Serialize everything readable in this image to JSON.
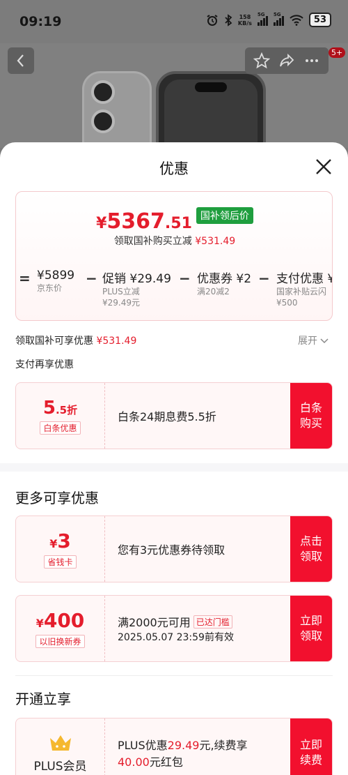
{
  "status_bar": {
    "time": "09:19",
    "speed_value": "158",
    "speed_unit": "KB/s",
    "sig1": "5G",
    "sig2": "5G",
    "battery": "53"
  },
  "header": {
    "cart_badge": "5+"
  },
  "sheet": {
    "title": "优惠",
    "price": {
      "yen": "¥",
      "integer": "5367",
      "decimal": ".51",
      "tag": "国补领后价",
      "sub_text": "领取国补购买立减",
      "sub_amount": "¥531.49"
    },
    "breakdown": [
      {
        "op": "=",
        "main": "¥5899",
        "sub1": "京东价",
        "sub2": ""
      },
      {
        "op": "−",
        "main": "促销 ¥29.49",
        "sub1": "PLUS立减",
        "sub2": "¥29.49元"
      },
      {
        "op": "−",
        "main": "优惠券 ¥2",
        "sub1": "满20减2",
        "sub2": ""
      },
      {
        "op": "−",
        "main": "支付优惠 ¥",
        "sub1": "国家补贴云闪",
        "sub2": "¥500"
      }
    ],
    "subsidy_label": "领取国补可享优惠",
    "subsidy_amount": "¥531.49",
    "expand_label": "展开",
    "pay_again_label": "支付再享优惠",
    "baitiao": {
      "big_num": "5",
      "big_suffix": ".5折",
      "chip": "白条优惠",
      "text": "白条24期息费5.5折",
      "action": "白条购买"
    },
    "more_title": "更多可享优惠",
    "coupon1": {
      "yen": "¥",
      "num": "3",
      "chip": "省钱卡",
      "text": "您有3元优惠券待领取",
      "action": "点击领取"
    },
    "coupon2": {
      "yen": "¥",
      "num": "400",
      "chip": "以旧换新券",
      "line1": "满2000元可用",
      "reached": "已达门槛",
      "line2": "2025.05.07 23:59前有效",
      "action": "立即领取"
    },
    "open_title": "开通立享",
    "plus": {
      "name": "PLUS会员",
      "t1": "PLUS优惠",
      "t2": "29.49",
      "t3": "元,续费享",
      "t4": "40.00",
      "t5": "元红包",
      "action": "立即续费"
    }
  },
  "colors": {
    "accent_red": "#e41d2c",
    "action_red": "#f2102e",
    "tag_green": "#1f9e3e"
  }
}
